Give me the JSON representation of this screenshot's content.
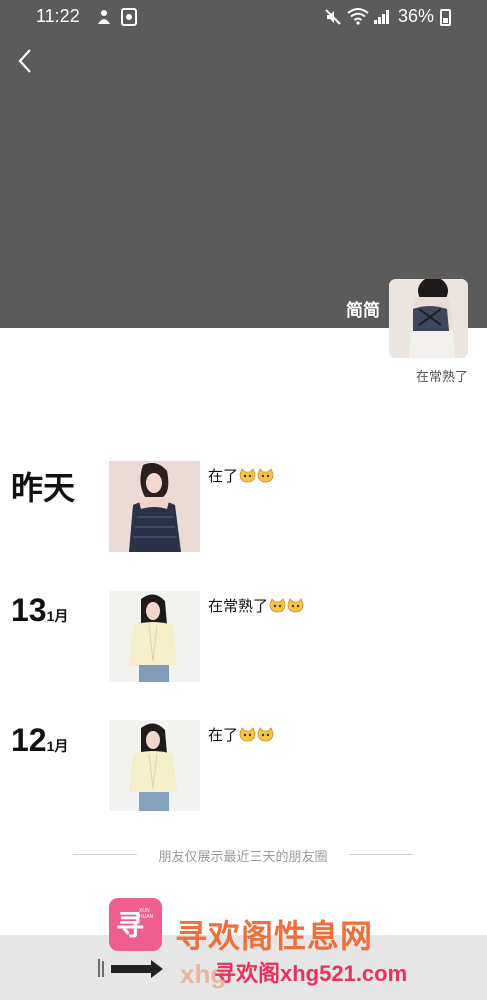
{
  "status_bar": {
    "time": "11:22",
    "battery": "36%",
    "icons": [
      "notification-icon",
      "screen-recorder-icon",
      "mute-icon",
      "wifi-icon",
      "signal-icon",
      "battery-icon"
    ]
  },
  "header": {
    "back_icon": "back-chevron-icon"
  },
  "profile": {
    "name": "简简",
    "signature": "在常熟了"
  },
  "posts": [
    {
      "day": "昨天",
      "month": "",
      "text": "在了",
      "emoji": [
        "cat-emoji",
        "cat-emoji"
      ]
    },
    {
      "day": "13",
      "month": "1月",
      "text": "在常熟了",
      "emoji": [
        "cat-emoji",
        "cat-emoji"
      ]
    },
    {
      "day": "12",
      "month": "1月",
      "text": "在了",
      "emoji": [
        "cat-emoji",
        "cat-emoji"
      ]
    }
  ],
  "footer": {
    "limit_notice": "朋友仅展示最近三天的朋友圈"
  },
  "watermark": {
    "logo_char": "寻",
    "logo_sub": "XUN HUAN",
    "title": "寻欢阁性息网",
    "url": "寻欢阁xhg521.com",
    "ghost": "xhg"
  },
  "colors": {
    "cover": "#5b5b5b",
    "watermark_title": "#ef6f3c",
    "watermark_url": "#e8315f",
    "logo": "#ee5f8f"
  }
}
